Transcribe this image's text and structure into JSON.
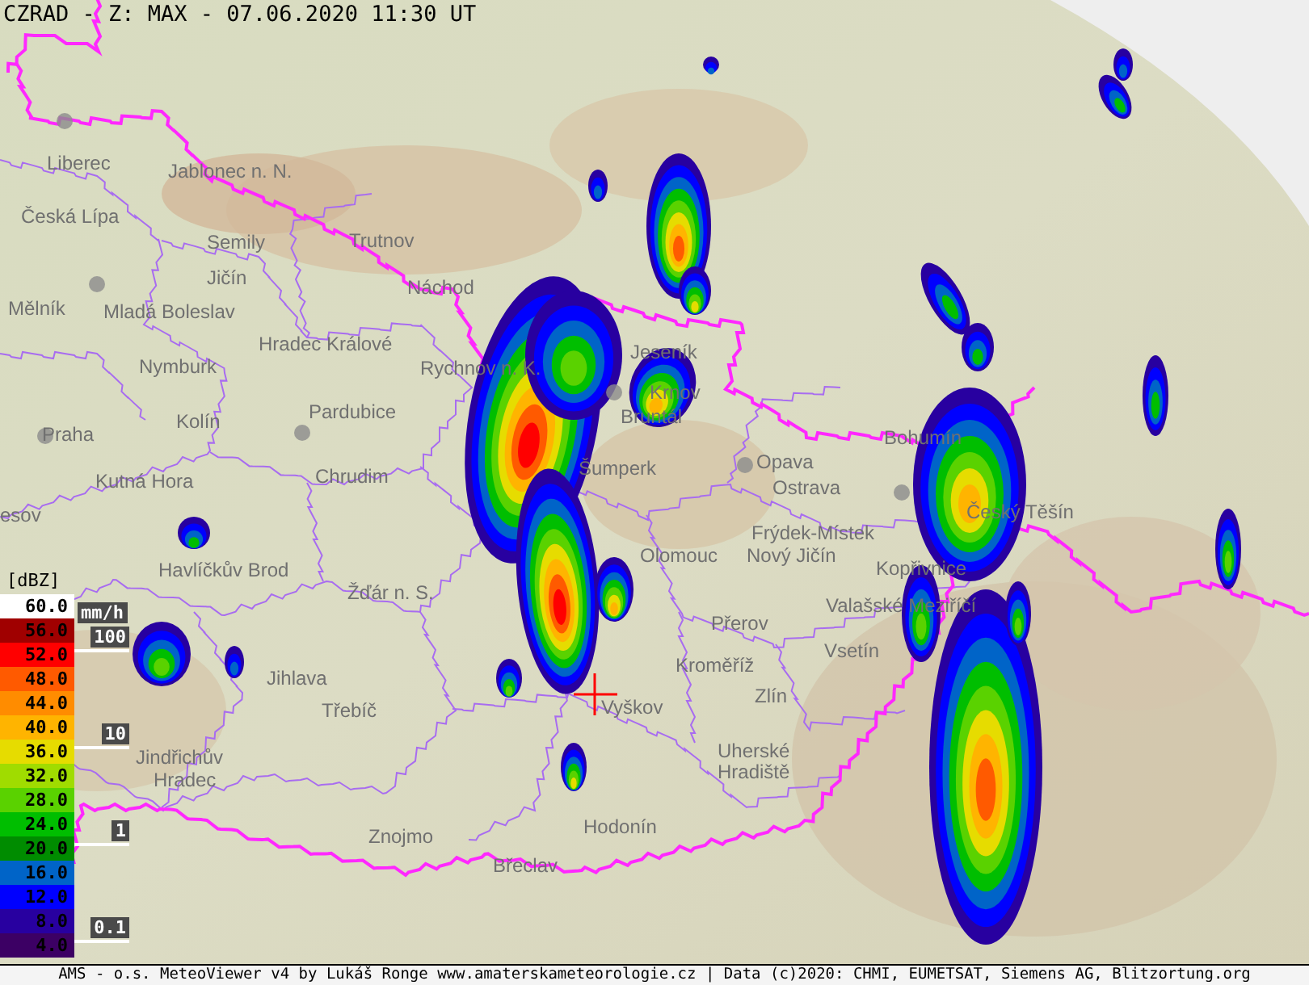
{
  "title": "CZRAD - Z: MAX - 07.06.2020 11:30 UT",
  "legend": {
    "unit": "[dBZ]",
    "steps": [
      {
        "label": "60.0",
        "color": "#ffffff"
      },
      {
        "label": "56.0",
        "color": "#a00000"
      },
      {
        "label": "52.0",
        "color": "#ff0000"
      },
      {
        "label": "48.0",
        "color": "#ff5a00"
      },
      {
        "label": "44.0",
        "color": "#ff8c00"
      },
      {
        "label": "40.0",
        "color": "#ffb400"
      },
      {
        "label": "36.0",
        "color": "#e6dc00"
      },
      {
        "label": "32.0",
        "color": "#a0dc00"
      },
      {
        "label": "28.0",
        "color": "#5ad200"
      },
      {
        "label": "24.0",
        "color": "#00be00"
      },
      {
        "label": "20.0",
        "color": "#008c00"
      },
      {
        "label": "16.0",
        "color": "#0064c8"
      },
      {
        "label": "12.0",
        "color": "#0000ff"
      },
      {
        "label": "8.0",
        "color": "#2800a0"
      },
      {
        "label": "4.0",
        "color": "#3c0064"
      }
    ]
  },
  "rain_scale": {
    "unit": "mm/h",
    "marks": [
      "100",
      "10",
      "1",
      "0.1"
    ]
  },
  "cities": [
    "Liberec",
    "Jablonec n. N.",
    "Česká Lípa",
    "Semily",
    "Trutnov",
    "Jičín",
    "Náchod",
    "Mělník",
    "Mladá Boleslav",
    "Hradec Králové",
    "Nymburk",
    "Rychnov n. K.",
    "Kolín",
    "Pardubice",
    "Praha",
    "Kutná Hora",
    "Chrudim",
    "esov",
    "Jeseník",
    "Krnov",
    "Bruntál",
    "Šumperk",
    "Opava",
    "Bohumín",
    "Ostrava",
    "Český Těšín",
    "Frýdek-Místek",
    "Nový Jičín",
    "Olomouc",
    "Kopřivnice",
    "Valašské Meziříčí",
    "Přerov",
    "Vsetín",
    "Kroměříž",
    "Zlín",
    "Vyškov",
    "Uherské",
    "Hradiště",
    "Hodonín",
    "Břeclav",
    "Znojmo",
    "Třebíč",
    "Jihlava",
    "Žďár n. S.",
    "Havlíčkův Brod",
    "Jindřichův",
    "Hradec"
  ],
  "footer": "AMS - o.s. MeteoViewer v4 by Lukáš Ronge www.amaterskameteorologie.cz | Data (c)2020: CHMI, EUMETSAT, Siemens AG, Blitzortung.org"
}
